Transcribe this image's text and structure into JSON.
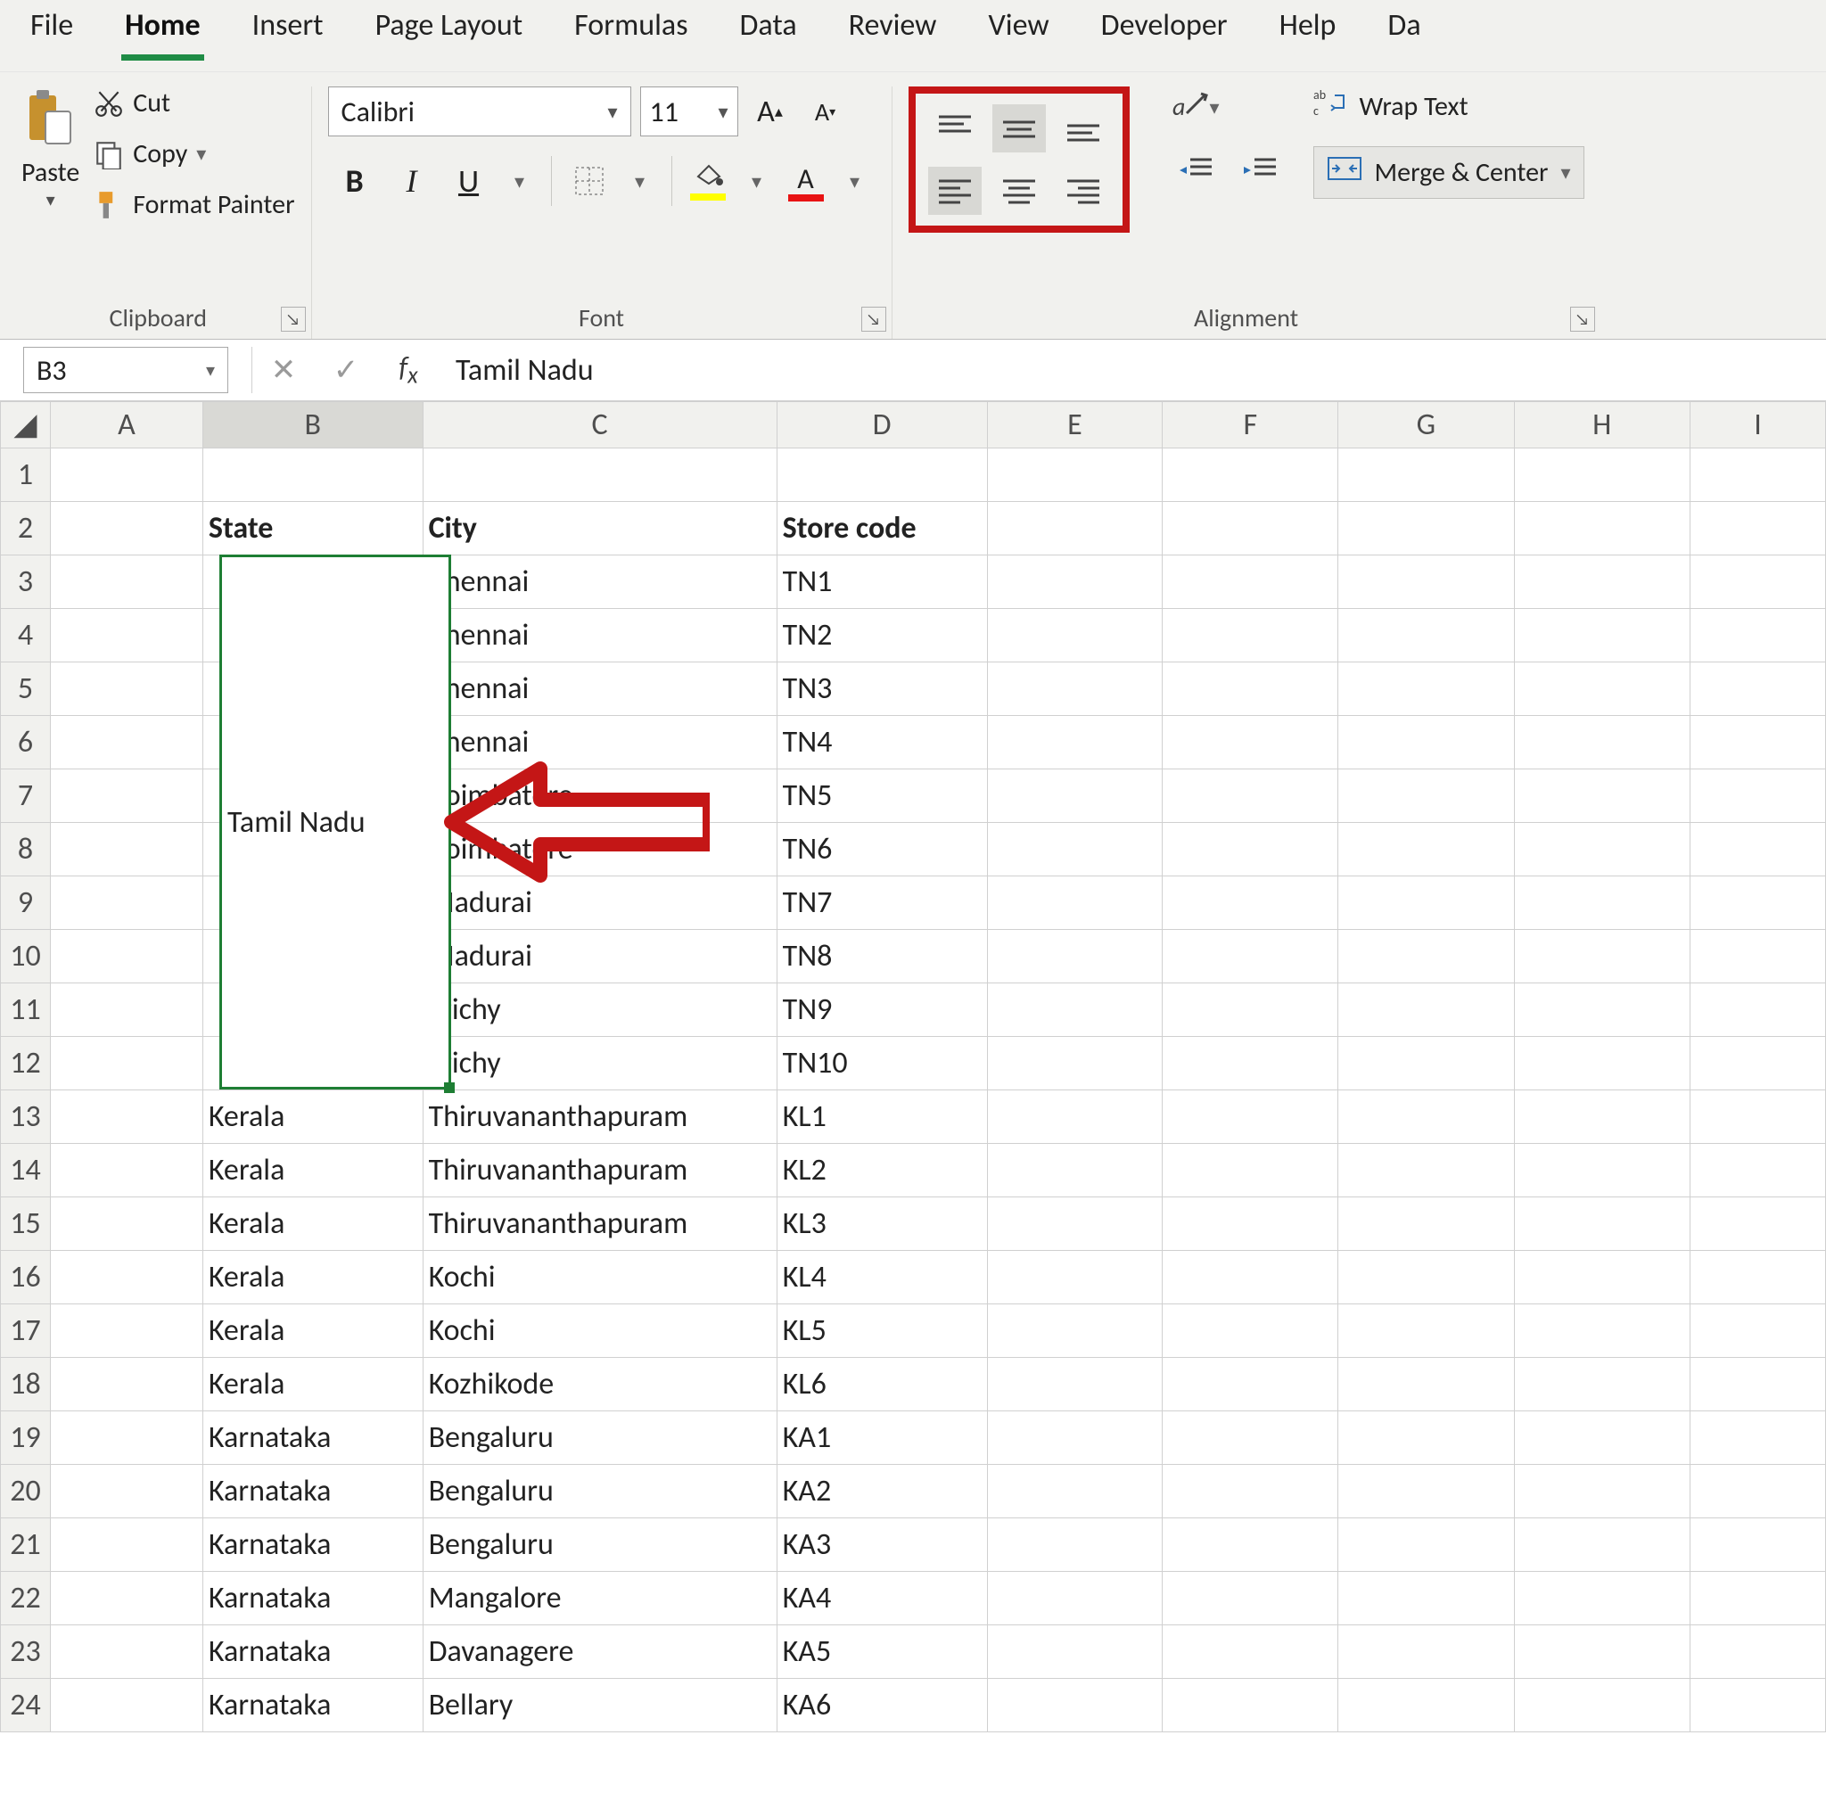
{
  "tabs": [
    "File",
    "Home",
    "Insert",
    "Page Layout",
    "Formulas",
    "Data",
    "Review",
    "View",
    "Developer",
    "Help",
    "Da"
  ],
  "active_tab_index": 1,
  "clipboard": {
    "paste": "Paste",
    "cut": "Cut",
    "copy": "Copy",
    "format_painter": "Format Painter",
    "group_label": "Clipboard"
  },
  "font": {
    "name": "Calibri",
    "size": "11",
    "group_label": "Font"
  },
  "alignment": {
    "group_label": "Alignment",
    "wrap_text": "Wrap Text",
    "merge_center": "Merge & Center"
  },
  "name_box": "B3",
  "formula_value": "Tamil Nadu",
  "columns": [
    "A",
    "B",
    "C",
    "D",
    "E",
    "F",
    "G",
    "H",
    "I"
  ],
  "row_numbers": [
    "1",
    "2",
    "3",
    "4",
    "5",
    "6",
    "7",
    "8",
    "9",
    "10",
    "11",
    "12",
    "13",
    "14",
    "15",
    "16",
    "17",
    "18",
    "19",
    "20",
    "21",
    "22",
    "23",
    "24"
  ],
  "headers": {
    "state": "State",
    "city": "City",
    "store_code": "Store code"
  },
  "merged_state": "Tamil Nadu",
  "rows": [
    {
      "state": "",
      "city": "Chennai",
      "code": "TN1"
    },
    {
      "state": "",
      "city": "Chennai",
      "code": "TN2"
    },
    {
      "state": "",
      "city": "Chennai",
      "code": "TN3"
    },
    {
      "state": "",
      "city": "Chennai",
      "code": "TN4"
    },
    {
      "state": "",
      "city": "Coimbatore",
      "code": "TN5"
    },
    {
      "state": "",
      "city": "Coimbatore",
      "code": "TN6"
    },
    {
      "state": "",
      "city": "Madurai",
      "code": "TN7"
    },
    {
      "state": "",
      "city": "Madurai",
      "code": "TN8"
    },
    {
      "state": "",
      "city": "Trichy",
      "code": "TN9"
    },
    {
      "state": "",
      "city": "Trichy",
      "code": "TN10"
    },
    {
      "state": "Kerala",
      "city": "Thiruvananthapuram",
      "code": "KL1"
    },
    {
      "state": "Kerala",
      "city": "Thiruvananthapuram",
      "code": "KL2"
    },
    {
      "state": "Kerala",
      "city": "Thiruvananthapuram",
      "code": "KL3"
    },
    {
      "state": "Kerala",
      "city": "Kochi",
      "code": "KL4"
    },
    {
      "state": "Kerala",
      "city": "Kochi",
      "code": "KL5"
    },
    {
      "state": "Kerala",
      "city": "Kozhikode",
      "code": "KL6"
    },
    {
      "state": "Karnataka",
      "city": "Bengaluru",
      "code": "KA1"
    },
    {
      "state": "Karnataka",
      "city": "Bengaluru",
      "code": "KA2"
    },
    {
      "state": "Karnataka",
      "city": "Bengaluru",
      "code": "KA3"
    },
    {
      "state": "Karnataka",
      "city": "Mangalore",
      "code": "KA4"
    },
    {
      "state": "Karnataka",
      "city": "Davanagere",
      "code": "KA5"
    },
    {
      "state": "Karnataka",
      "city": "Bellary",
      "code": "KA6"
    }
  ]
}
